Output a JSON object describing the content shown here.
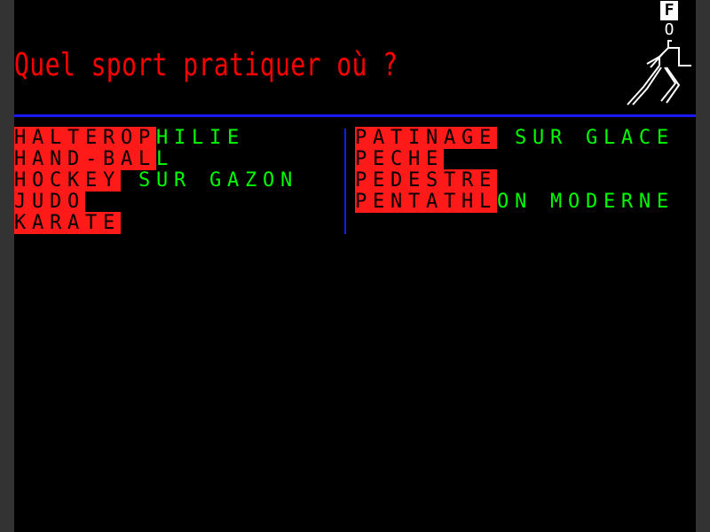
{
  "colors": {
    "screen_bg": "#000000",
    "frame": "#333333",
    "title_red": "#ff0000",
    "highlight_red": "#ff1a1a",
    "text_green": "#00ff00",
    "text_black": "#000000",
    "rule_blue": "#1a1aff",
    "white": "#ffffff"
  },
  "header": {
    "title": "Quel sport pratiquer où ?",
    "logo_letter": "F",
    "logo_sub": "O",
    "runner_icon": "runner-icon"
  },
  "left_column": [
    {
      "hl": "HALTEROP",
      "rest": "HILIE"
    },
    {
      "hl": "HAND-BAL",
      "rest": "L"
    },
    {
      "hl": "HOCKEY",
      "rest": " SUR GAZON"
    },
    {
      "hl": "JUDO",
      "rest": ""
    },
    {
      "hl": "KARATE",
      "rest": ""
    }
  ],
  "right_column": [
    {
      "hl": "PATINAGE",
      "rest": " SUR GLACE"
    },
    {
      "hl": "PECHE",
      "rest": ""
    },
    {
      "hl": "PEDESTRE",
      "rest": ""
    },
    {
      "hl": "PENTATHL",
      "rest": "ON MODERNE"
    }
  ]
}
